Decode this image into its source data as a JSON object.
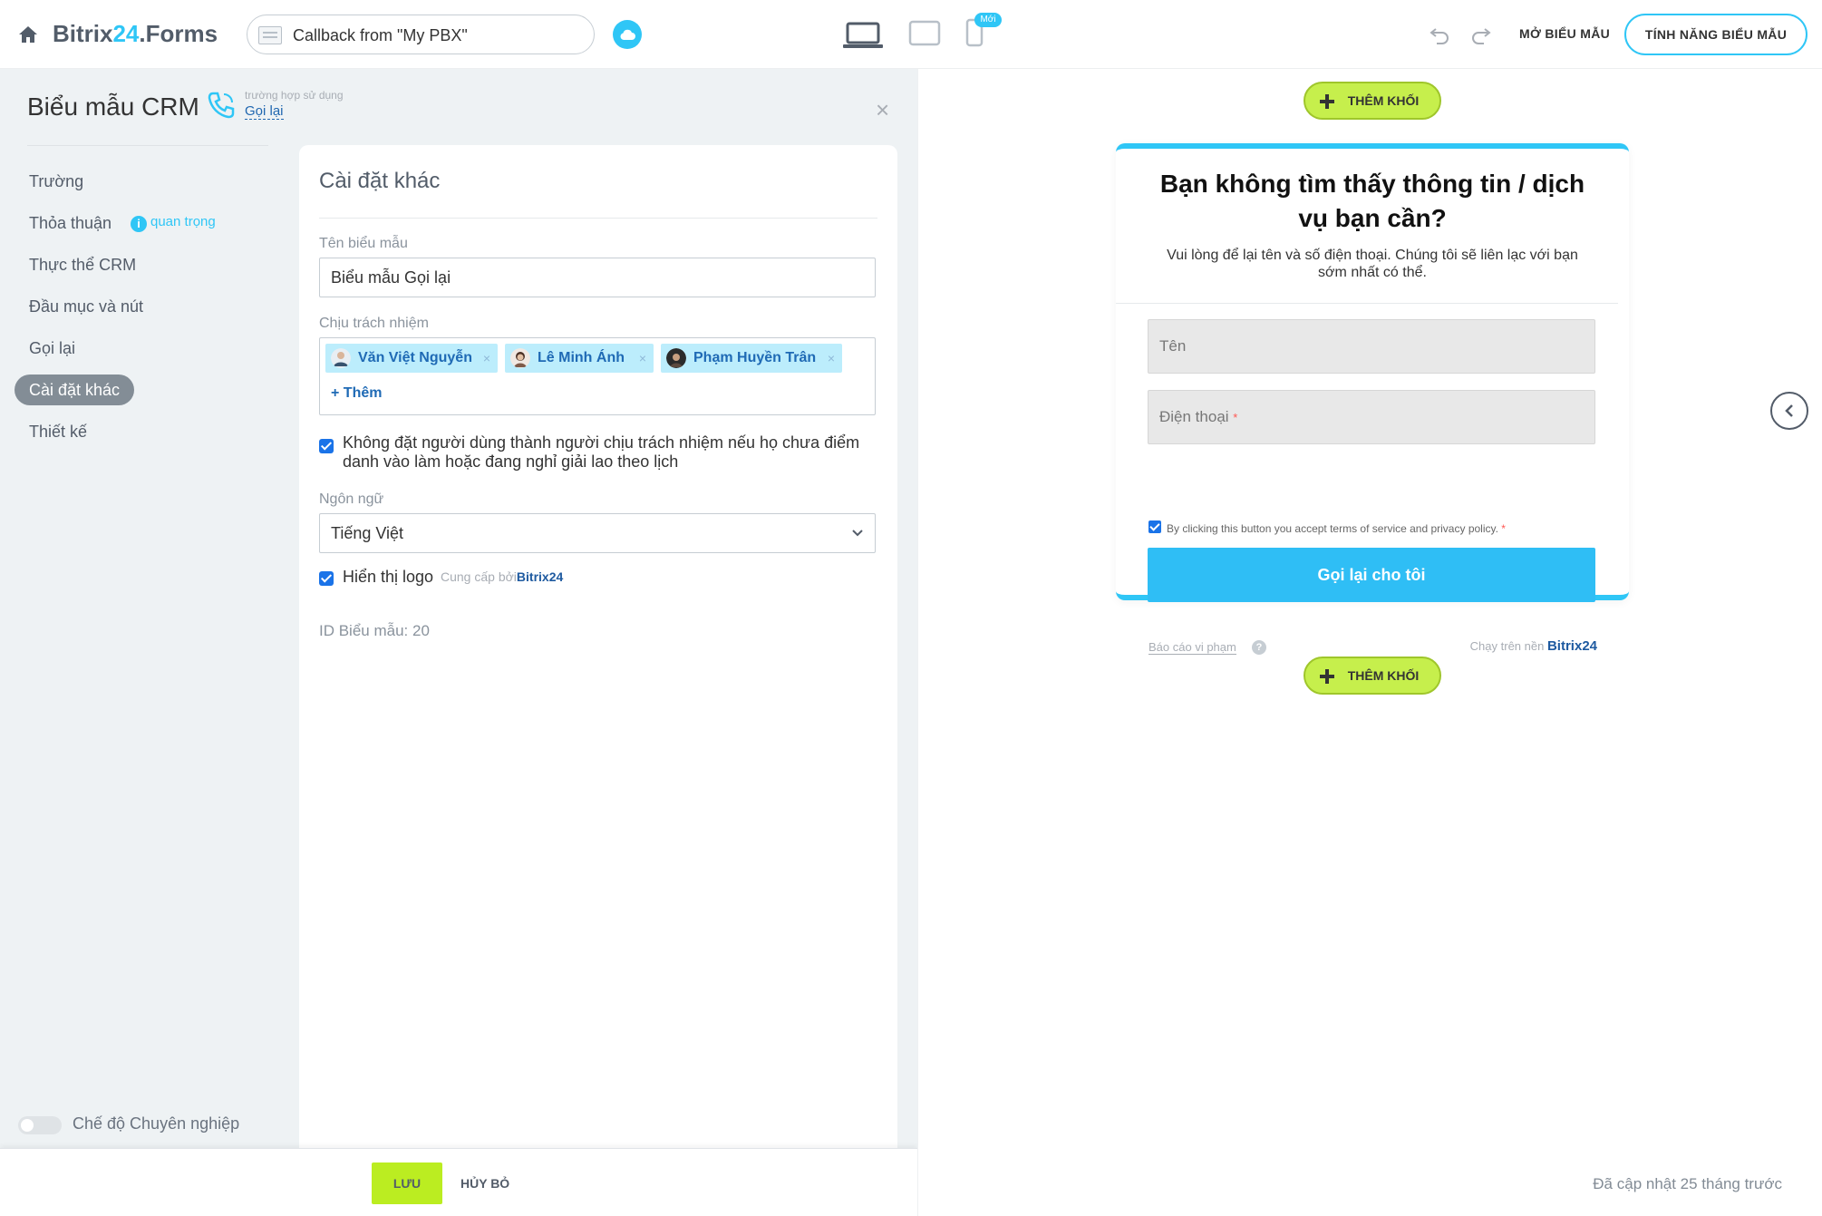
{
  "header": {
    "brand_prefix": "Bitrix",
    "brand_num": "24",
    "brand_suffix": ".Forms",
    "form_selector_value": "Callback from \"My PBX\"",
    "new_badge": "Mới",
    "open_form_label": "MỞ BIỂU MẪU",
    "features_label": "TÍNH NĂNG BIỂU MẪU",
    "accent_color": "#2fc6f6"
  },
  "sidebar": {
    "title": "Biểu mẫu CRM",
    "scenario_label": "trường hợp sử dụng",
    "scenario_value": "Gọi lại",
    "items": [
      {
        "label": "Trường",
        "active": false
      },
      {
        "label": "Thỏa thuận",
        "active": false
      },
      {
        "label": "Thực thể CRM",
        "active": false
      },
      {
        "label": "Đầu mục và nút",
        "active": false
      },
      {
        "label": "Gọi lại",
        "active": false
      },
      {
        "label": "Cài đặt khác",
        "active": true
      },
      {
        "label": "Thiết kế",
        "active": false
      }
    ],
    "important_label": "quan trọng",
    "pro_mode_label": "Chế độ Chuyên nghiệp",
    "pro_mode_on": false
  },
  "settings": {
    "title": "Cài đặt khác",
    "form_name_label": "Tên biểu mẫu",
    "form_name_value": "Biểu mẫu Gọi lại",
    "responsible_label": "Chịu trách nhiệm",
    "responsible": [
      "Văn Việt Nguyễn",
      "Lê Minh Ánh",
      "Phạm Huyền Trân"
    ],
    "add_label": "+ Thêm",
    "skip_absent_checked": true,
    "skip_absent_text": "Không đặt người dùng thành người chịu trách nhiệm nếu họ chưa điểm danh vào làm hoặc đang nghỉ giải lao theo lịch",
    "language_label": "Ngôn ngữ",
    "language_value": "Tiếng Việt",
    "show_logo_checked": true,
    "show_logo_text": "Hiển thị logo",
    "powered_by_text": "Cung cấp bởi",
    "powered_brand": "Bitrix",
    "powered_brand_num": "24",
    "form_id_text": "ID Biểu mẫu: 20"
  },
  "footer": {
    "save_label": "LƯU",
    "cancel_label": "HỦY BỎ"
  },
  "preview": {
    "add_block_label": "THÊM KHỐI",
    "heading": "Bạn không tìm thấy thông tin / dịch vụ bạn cần?",
    "subheading": "Vui lòng để lại tên và số điện thoại. Chúng tôi sẽ liên lạc với bạn sớm nhất có thể.",
    "name_placeholder": "Tên",
    "phone_placeholder": "Điện thoại",
    "required_mark": "*",
    "terms_text": "By clicking this button you accept terms of service and privacy policy.",
    "terms_checked": true,
    "submit_label": "Gọi lại cho tôi",
    "report_label": "Báo cáo vi phạm",
    "help_glyph": "?",
    "runs_on_text": "Chạy trên nền",
    "runs_brand": "Bitrix",
    "runs_brand_num": "24",
    "updated_text": "Đã cập nhật 25 tháng trước"
  }
}
